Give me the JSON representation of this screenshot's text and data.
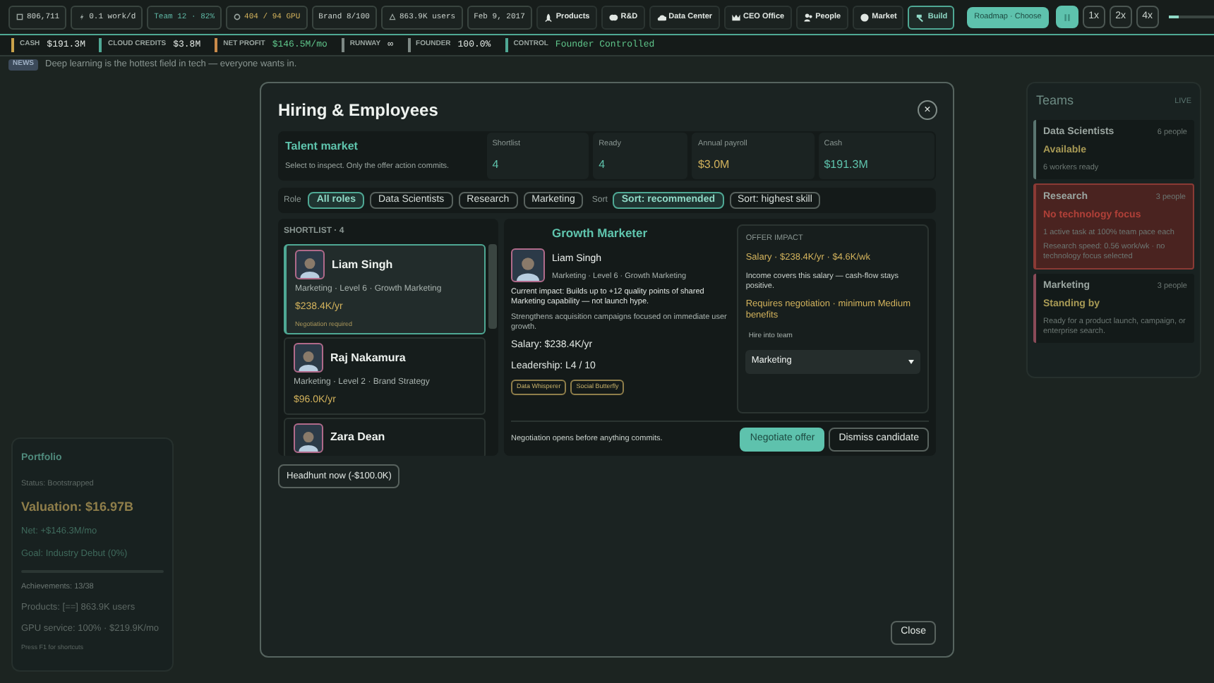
{
  "top_stats": [
    {
      "text": "806,711",
      "color": "#c9d1cc"
    },
    {
      "text": "0.1 work/d",
      "color": "#c9d1cc"
    },
    {
      "text": "Team 12 · 82%",
      "color": "#5fb8a5"
    },
    {
      "text": "404 / 94 GPU",
      "color": "#d2b25c"
    },
    {
      "text": "Brand 8/100",
      "color": "#c9d1cc"
    },
    {
      "text": "863.9K users",
      "color": "#c9d1cc"
    },
    {
      "text": "Feb 9, 2017",
      "color": "#c9d1cc"
    }
  ],
  "nav": [
    {
      "label": "Products",
      "selected": false
    },
    {
      "label": "R&D",
      "selected": false
    },
    {
      "label": "Data Center",
      "selected": false
    },
    {
      "label": "CEO Office",
      "selected": false
    },
    {
      "label": "People",
      "selected": false
    },
    {
      "label": "Market",
      "selected": false
    },
    {
      "label": "Build",
      "selected": true
    }
  ],
  "roadmap_button": "Roadmap · Choose",
  "speed_controls": [
    {
      "kind": "pause",
      "selected": true
    },
    {
      "kind": "rate",
      "label": "1x",
      "selected": false
    },
    {
      "kind": "rate",
      "label": "2x",
      "selected": false
    },
    {
      "kind": "rate",
      "label": "4x",
      "selected": false
    }
  ],
  "speed_slider": {
    "level": 0.2
  },
  "status_bar": [
    {
      "label": "CASH",
      "value": "$191.3M",
      "color": "#c9a24a",
      "highlight": false
    },
    {
      "label": "CLOUD CREDITS",
      "value": "$3.8M",
      "color": "#4fa894",
      "highlight": false
    },
    {
      "label": "NET PROFIT",
      "value": "$146.5M/mo",
      "color": "#c98a4a",
      "highlight": true
    },
    {
      "label": "RUNWAY",
      "value": "∞",
      "color": "#7d8884",
      "highlight": false
    },
    {
      "label": "FOUNDER",
      "value": "100.0%",
      "color": "#7d8884",
      "highlight": false
    },
    {
      "label": "CONTROL",
      "value": "Founder Controlled",
      "color": "#4fa894",
      "highlight": true
    }
  ],
  "news": {
    "badge": "NEWS",
    "text": "Deep learning is the hottest field in tech — everyone wants in."
  },
  "teams_panel": {
    "title": "Teams",
    "badge": "LIVE",
    "teams": [
      {
        "name": "Data Scientists",
        "count": "6 people",
        "status": "Available",
        "details": [
          "6 workers ready"
        ],
        "kind": "available"
      },
      {
        "name": "Research",
        "count": "3 people",
        "status": "No technology focus",
        "details": [
          "1 active task at 100% team pace each",
          "Research speed: 0.56 work/wk · no technology focus selected"
        ],
        "kind": "blocked"
      },
      {
        "name": "Marketing",
        "count": "3 people",
        "status": "Standing by",
        "details": [
          "Ready for a product launch, campaign, or enterprise search."
        ],
        "kind": "standby"
      }
    ]
  },
  "portfolio": {
    "title": "Portfolio",
    "status": "Status: Bootstrapped",
    "valuation": "Valuation: $16.97B",
    "net": "Net: +$146.3M/mo",
    "goal": "Goal: Industry Debut (0%)",
    "goal_progress": {
      "level": 0
    },
    "achievements": "Achievements: 13/38",
    "products": "Products: [==] 863.9K users",
    "gpu": "GPU service: 100% · $219.9K/mo",
    "hint": "Press F1 for shortcuts"
  },
  "modal": {
    "title": "Hiring & Employees",
    "close_icon": "×",
    "summary": {
      "title": "Talent market",
      "subtitle": "Select to inspect. Only the offer action commits.",
      "stats": [
        {
          "label": "Shortlist",
          "value": "4",
          "color": "#5fc4ad"
        },
        {
          "label": "Ready",
          "value": "4",
          "color": "#5fc4ad"
        },
        {
          "label": "Annual payroll",
          "value": "$3.0M",
          "color": "#d2b25c"
        },
        {
          "label": "Cash",
          "value": "$191.3M",
          "color": "#5fc4ad"
        }
      ]
    },
    "filters": {
      "role_label": "Role",
      "roles": [
        {
          "label": "All roles",
          "selected": true
        },
        {
          "label": "Data Scientists",
          "selected": false
        },
        {
          "label": "Research",
          "selected": false
        },
        {
          "label": "Marketing",
          "selected": false
        }
      ],
      "sort_label": "Sort",
      "sorts": [
        {
          "label": "Sort: recommended",
          "selected": true
        },
        {
          "label": "Sort: highest skill",
          "selected": false
        }
      ]
    },
    "shortlist": {
      "heading": "SHORTLIST · 4",
      "candidates": [
        {
          "name": "Liam Singh",
          "meta": "Marketing · Level 6 · Growth Marketing",
          "salary": "$238.4K/yr",
          "note": "Negotiation required",
          "selected": true
        },
        {
          "name": "Raj Nakamura",
          "meta": "Marketing · Level 2 · Brand Strategy",
          "salary": "$96.0K/yr",
          "selected": false
        },
        {
          "name": "Zara Dean",
          "selected": false
        }
      ]
    },
    "headhunt_button": "Headhunt now (-$100.0K)",
    "detail": {
      "role": "Growth Marketer",
      "name": "Liam Singh",
      "meta": "Marketing · Level 6 · Growth Marketing",
      "impact": "Current impact: Builds up to +12 quality points of shared Marketing capability — not launch hype.",
      "description": "Strengthens acquisition campaigns focused on immediate user growth.",
      "salary": "Salary: $238.4K/yr",
      "leadership": "Leadership: L4 / 10",
      "traits": [
        "Data Whisperer",
        "Social Butterfly"
      ],
      "footnote": "Negotiation opens before anything commits."
    },
    "offer": {
      "heading": "OFFER IMPACT",
      "salary": "Salary · $238.4K/yr · $4.6K/wk",
      "income": "Income covers this salary — cash-flow stays positive.",
      "requirement": "Requires negotiation · minimum Medium benefits",
      "team_label": "Hire into team",
      "team_value": "Marketing"
    },
    "actions": [
      {
        "label": "Negotiate offer",
        "kind": "primary"
      },
      {
        "label": "Dismiss candidate",
        "kind": "secondary"
      }
    ],
    "close_button": "Close"
  }
}
